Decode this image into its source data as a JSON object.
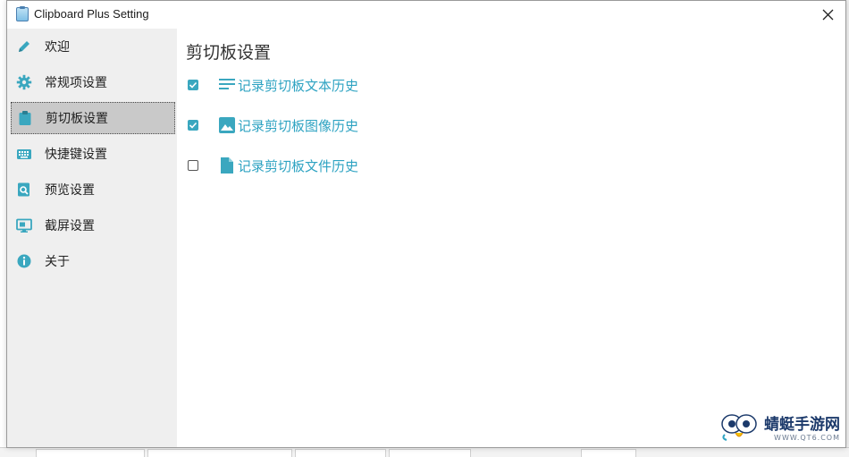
{
  "window": {
    "title": "Clipboard Plus Setting"
  },
  "colors": {
    "accent": "#3aa7bf",
    "link": "#2ea3c2",
    "selected_bg": "#c9c9c9"
  },
  "sidebar": {
    "items": [
      {
        "label": "欢迎",
        "icon": "pen-icon"
      },
      {
        "label": "常规项设置",
        "icon": "gear-icon"
      },
      {
        "label": "剪切板设置",
        "icon": "clipboard-icon",
        "selected": true
      },
      {
        "label": "快捷键设置",
        "icon": "keyboard-icon"
      },
      {
        "label": "预览设置",
        "icon": "preview-search-icon"
      },
      {
        "label": "截屏设置",
        "icon": "screenshot-icon"
      },
      {
        "label": "关于",
        "icon": "info-icon"
      }
    ]
  },
  "content": {
    "title": "剪切板设置",
    "options": [
      {
        "label": "记录剪切板文本历史",
        "checked": true,
        "icon": "text-lines-icon"
      },
      {
        "label": "记录剪切板图像历史",
        "checked": true,
        "icon": "image-icon"
      },
      {
        "label": "记录剪切板文件历史",
        "checked": false,
        "icon": "file-icon"
      }
    ]
  },
  "watermark": {
    "main": "蜻蜓手游网",
    "sub": "WWW.QT6.COM"
  }
}
